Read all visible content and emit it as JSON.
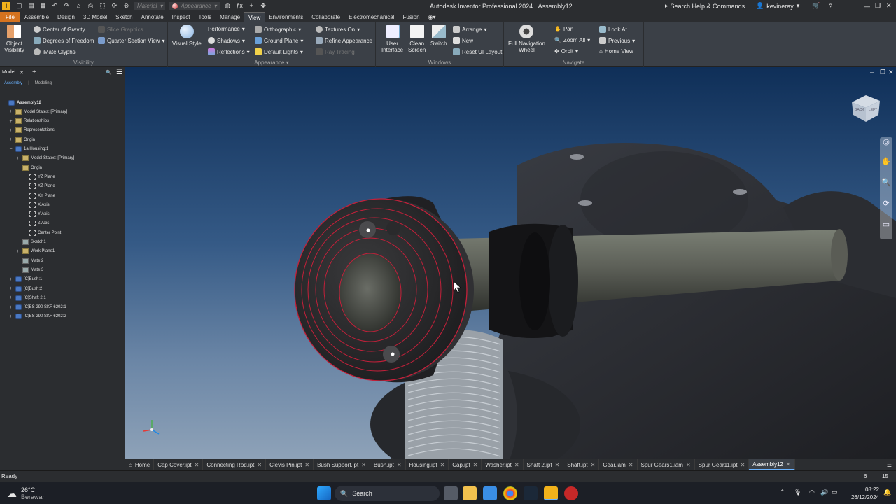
{
  "window": {
    "app_icon": "I",
    "title": "Autodesk Inventor Professional 2024",
    "document": "Assembly12",
    "search_placeholder": "Search Help & Commands...",
    "user": "kevineray",
    "material_combo": "Material",
    "appearance_combo": "Appearance"
  },
  "menu_tabs": [
    "File",
    "Assemble",
    "Design",
    "3D Model",
    "Sketch",
    "Annotate",
    "Inspect",
    "Tools",
    "Manage",
    "View",
    "Environments",
    "Collaborate",
    "Electromechanical",
    "Fusion"
  ],
  "active_tab": "View",
  "ribbon": {
    "visibility": {
      "label": "Visibility",
      "object_visibility": "Object\nVisibility",
      "center_of_gravity": "Center of Gravity",
      "degrees_of_freedom": "Degrees of Freedom",
      "imate_glyphs": "iMate Glyphs",
      "slice_graphics": "Slice Graphics",
      "quarter_section_view": "Quarter Section View"
    },
    "appearance": {
      "label": "Appearance",
      "visual_style": "Visual Style",
      "performance": "Performance",
      "shadows": "Shadows",
      "reflections": "Reflections",
      "orthographic": "Orthographic",
      "ground_plane": "Ground Plane",
      "default_lights": "Default Lights",
      "textures_on": "Textures On",
      "refine_appearance": "Refine Appearance",
      "ray_tracing": "Ray Tracing"
    },
    "windows": {
      "label": "Windows",
      "user_interface": "User\nInterface",
      "clean_screen": "Clean\nScreen",
      "switch": "Switch",
      "arrange": "Arrange",
      "new": "New",
      "reset_ui_layout": "Reset UI Layout"
    },
    "navigate": {
      "label": "Navigate",
      "full_navigation_wheel": "Full Navigation\nWheel",
      "pan": "Pan",
      "zoom_all": "Zoom All",
      "orbit": "Orbit",
      "look_at": "Look At",
      "previous": "Previous",
      "home_view": "Home View"
    }
  },
  "browser": {
    "tab": "Model",
    "subtabs": [
      "Assembly",
      "Modeling"
    ],
    "tree": [
      {
        "label": "Assembly12",
        "indent": 0,
        "icon": "assembly",
        "exp": ""
      },
      {
        "label": "Model States: [Primary]",
        "indent": 1,
        "icon": "folder",
        "exp": "+"
      },
      {
        "label": "Relationships",
        "indent": 1,
        "icon": "folder",
        "exp": "+"
      },
      {
        "label": "Representations",
        "indent": 1,
        "icon": "folder",
        "exp": "+"
      },
      {
        "label": "Origin",
        "indent": 1,
        "icon": "folder",
        "exp": "+"
      },
      {
        "label": "1a:Housing:1",
        "indent": 1,
        "icon": "part",
        "exp": "−"
      },
      {
        "label": "Model States: [Primary]",
        "indent": 2,
        "icon": "folder",
        "exp": "+"
      },
      {
        "label": "Origin",
        "indent": 2,
        "icon": "folder",
        "exp": "−"
      },
      {
        "label": "YZ Plane",
        "indent": 3,
        "icon": "plane",
        "exp": ""
      },
      {
        "label": "XZ Plane",
        "indent": 3,
        "icon": "plane",
        "exp": ""
      },
      {
        "label": "XY Plane",
        "indent": 3,
        "icon": "plane",
        "exp": ""
      },
      {
        "label": "X Axis",
        "indent": 3,
        "icon": "plane",
        "exp": ""
      },
      {
        "label": "Y Axis",
        "indent": 3,
        "icon": "plane",
        "exp": ""
      },
      {
        "label": "Z Axis",
        "indent": 3,
        "icon": "plane",
        "exp": ""
      },
      {
        "label": "Center Point",
        "indent": 3,
        "icon": "point",
        "exp": ""
      },
      {
        "label": "Sketch1",
        "indent": 2,
        "icon": "sketch",
        "exp": ""
      },
      {
        "label": "Work Plane1",
        "indent": 2,
        "icon": "folder",
        "exp": "+"
      },
      {
        "label": "Mate:2",
        "indent": 2,
        "icon": "mate",
        "exp": ""
      },
      {
        "label": "Mate:3",
        "indent": 2,
        "icon": "mate",
        "exp": ""
      },
      {
        "label": "[C]Bush:1",
        "indent": 1,
        "icon": "part",
        "exp": "+"
      },
      {
        "label": "[C]Bush:2",
        "indent": 1,
        "icon": "part",
        "exp": "+"
      },
      {
        "label": "[C]Shaft 2:1",
        "indent": 1,
        "icon": "part",
        "exp": "+"
      },
      {
        "label": "[C]BS 290 SKF 6202:1",
        "indent": 1,
        "icon": "assembly",
        "exp": "+"
      },
      {
        "label": "[C]BS 290 SKF 6202:2",
        "indent": 1,
        "icon": "assembly",
        "exp": "+"
      }
    ]
  },
  "viewcube": {
    "face": "BACK",
    "side": "LEFT"
  },
  "doc_tabs": [
    {
      "label": "Home",
      "active": false,
      "home": true
    },
    {
      "label": "Cap Cover.ipt",
      "active": false
    },
    {
      "label": "Connecting Rod.ipt",
      "active": false
    },
    {
      "label": "Clevis Pin.ipt",
      "active": false
    },
    {
      "label": "Bush Support.ipt",
      "active": false
    },
    {
      "label": "Bush.ipt",
      "active": false
    },
    {
      "label": "Housing.ipt",
      "active": false
    },
    {
      "label": "Cap.ipt",
      "active": false
    },
    {
      "label": "Washer.ipt",
      "active": false
    },
    {
      "label": "Shaft 2.ipt",
      "active": false
    },
    {
      "label": "Shaft.ipt",
      "active": false
    },
    {
      "label": "Gear.iam",
      "active": false
    },
    {
      "label": "Spur Gears1.iam",
      "active": false
    },
    {
      "label": "Spur Gear11.ipt",
      "active": false
    },
    {
      "label": "Assembly12",
      "active": true
    }
  ],
  "status": {
    "text": "Ready",
    "num1": "6",
    "num2": "15"
  },
  "taskbar": {
    "weather_temp": "26°C",
    "weather_desc": "Berawan",
    "search_label": "Search",
    "time": "08:22",
    "date": "26/12/2024"
  },
  "colors": {
    "accent": "#d5731f",
    "ribbon_bg": "#3b4047",
    "select_highlight": "#c4203a",
    "taskbar": "#1c1f26"
  }
}
